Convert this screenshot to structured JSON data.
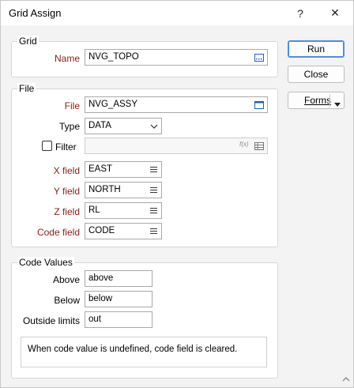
{
  "window": {
    "title": "Grid Assign",
    "help": "?",
    "close": "✕"
  },
  "grid": {
    "label": "Grid",
    "name_label": "Name",
    "name_value": "NVG_TOPO"
  },
  "file": {
    "label": "File",
    "file_label": "File",
    "file_value": "NVG_ASSY",
    "type_label": "Type",
    "type_value": "DATA",
    "filter_label": "Filter",
    "filter_value": "",
    "filter_fx": "f(x)",
    "xfield_label": "X field",
    "xfield_value": "EAST",
    "yfield_label": "Y field",
    "yfield_value": "NORTH",
    "zfield_label": "Z field",
    "zfield_value": "RL",
    "codefield_label": "Code field",
    "codefield_value": "CODE"
  },
  "code_values": {
    "label": "Code Values",
    "above_label": "Above",
    "above_value": "above",
    "below_label": "Below",
    "below_value": "below",
    "outside_label": "Outside limits",
    "outside_value": "out",
    "note": "When code value is undefined, code field is cleared."
  },
  "buttons": {
    "run": "Run",
    "close": "Close",
    "forms": "Forms"
  },
  "colors": {
    "required_label": "#8b1a1a",
    "focus_border": "#4a8ee6"
  }
}
